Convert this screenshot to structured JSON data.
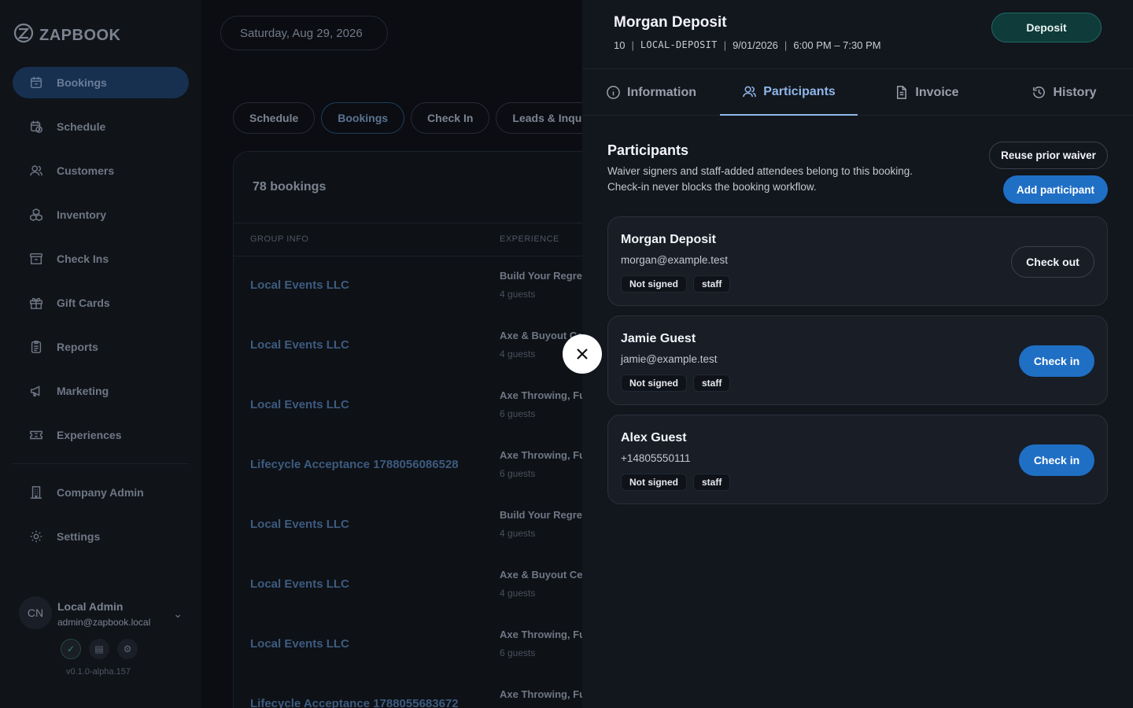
{
  "app": {
    "name": "ZAPBOOK"
  },
  "sidebar": {
    "items": [
      {
        "label": "Bookings",
        "icon": "calendar-icon",
        "active": true
      },
      {
        "label": "Schedule",
        "icon": "calendar-clock-icon",
        "active": false
      },
      {
        "label": "Customers",
        "icon": "users-icon",
        "active": false
      },
      {
        "label": "Inventory",
        "icon": "boxes-icon",
        "active": false
      },
      {
        "label": "Check Ins",
        "icon": "archive-icon",
        "active": false
      },
      {
        "label": "Gift Cards",
        "icon": "gift-icon",
        "active": false
      },
      {
        "label": "Reports",
        "icon": "clipboard-icon",
        "active": false
      },
      {
        "label": "Marketing",
        "icon": "megaphone-icon",
        "active": false
      },
      {
        "label": "Experiences",
        "icon": "ticket-icon",
        "active": false
      }
    ],
    "admin_items": [
      {
        "label": "Company Admin",
        "icon": "building-icon"
      },
      {
        "label": "Settings",
        "icon": "gear-icon"
      }
    ],
    "user": {
      "initials": "CN",
      "name": "Local Admin",
      "email": "admin@zapbook.local"
    },
    "version": "v0.1.0-alpha.157"
  },
  "main": {
    "date": "Saturday, Aug 29, 2026",
    "tabs": [
      "Schedule",
      "Bookings",
      "Check In",
      "Leads & Inquiries"
    ],
    "active_tab": "Bookings",
    "count": "78 bookings",
    "columns": [
      "GROUP INFO",
      "EXPERIENCE"
    ],
    "rows": [
      {
        "group": "Local Events LLC",
        "experience": "Build Your Regret",
        "guests": "4 guests"
      },
      {
        "group": "Local Events LLC",
        "experience": "Axe & Buyout Ce",
        "guests": "4 guests"
      },
      {
        "group": "Local Events LLC",
        "experience": "Axe Throwing, Fu",
        "guests": "6 guests"
      },
      {
        "group": "Lifecycle Acceptance 1788056086528",
        "experience": "Axe Throwing, Fu",
        "guests": "6 guests"
      },
      {
        "group": "Local Events LLC",
        "experience": "Build Your Regret",
        "guests": "4 guests"
      },
      {
        "group": "Local Events LLC",
        "experience": "Axe & Buyout Ce",
        "guests": "4 guests"
      },
      {
        "group": "Local Events LLC",
        "experience": "Axe Throwing, Fu",
        "guests": "6 guests"
      },
      {
        "group": "Lifecycle Acceptance 1788055683672",
        "experience": "Axe Throwing, Fu",
        "guests": ""
      }
    ]
  },
  "drawer": {
    "title": "Morgan Deposit",
    "meta": {
      "id": "10",
      "code": "LOCAL-DEPOSIT",
      "date": "9/01/2026",
      "time": "6:00 PM – 7:30 PM",
      "sep": "|"
    },
    "status_button": "Deposit",
    "tabs": [
      {
        "label": "Information",
        "icon": "info-icon"
      },
      {
        "label": "Participants",
        "icon": "users-icon"
      },
      {
        "label": "Invoice",
        "icon": "document-icon"
      },
      {
        "label": "History",
        "icon": "history-icon"
      }
    ],
    "active_tab": "Participants",
    "participants": {
      "heading": "Participants",
      "description_line1": "Waiver signers and staff-added attendees belong to this booking.",
      "description_line2": "Check-in never blocks the booking workflow.",
      "reuse_button": "Reuse prior waiver",
      "add_button": "Add participant",
      "list": [
        {
          "name": "Morgan Deposit",
          "contact": "morgan@example.test",
          "waiver": "Not signed",
          "role": "staff",
          "action": "Check out",
          "action_style": "outline"
        },
        {
          "name": "Jamie Guest",
          "contact": "jamie@example.test",
          "waiver": "Not signed",
          "role": "staff",
          "action": "Check in",
          "action_style": "primary"
        },
        {
          "name": "Alex Guest",
          "contact": "+14805550111",
          "waiver": "Not signed",
          "role": "staff",
          "action": "Check in",
          "action_style": "primary"
        }
      ]
    }
  },
  "colors": {
    "accent": "#1f6fc5",
    "deposit": "#0f3b3a",
    "active_tab": "#8fb7e8"
  }
}
